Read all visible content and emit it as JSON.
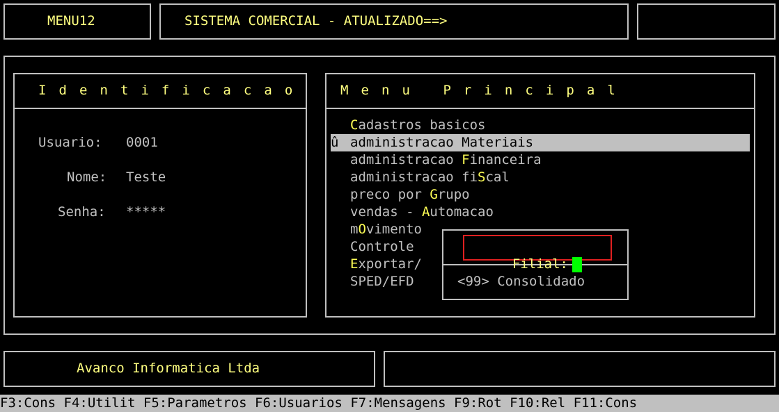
{
  "header": {
    "menu_code": "MENU12",
    "title": "SISTEMA COMERCIAL - ATUALIZADO==>"
  },
  "identificacao": {
    "heading": "Identificacao",
    "usuario_label": "Usuario:",
    "usuario_value": "0001",
    "nome_label": "Nome:",
    "nome_value": "Teste",
    "senha_label": "Senha:",
    "senha_value": "*****"
  },
  "menu": {
    "heading": "Menu Principal",
    "selected_marker": "û",
    "items": [
      {
        "pre": "",
        "hot": "C",
        "post": "adastros basicos"
      },
      {
        "pre": "administracao ",
        "hot": "M",
        "post": "ateriais"
      },
      {
        "pre": "administracao ",
        "hot": "F",
        "post": "inanceira"
      },
      {
        "pre": "administracao fi",
        "hot": "S",
        "post": "cal"
      },
      {
        "pre": "preco por ",
        "hot": "G",
        "post": "rupo"
      },
      {
        "pre": "vendas - ",
        "hot": "A",
        "post": "utomacao"
      },
      {
        "pre": "m",
        "hot": "O",
        "post": "vimento"
      },
      {
        "pre": "",
        "hot": "",
        "post": "Controle"
      },
      {
        "pre": "",
        "hot": "E",
        "post": "xportar/"
      },
      {
        "pre": "",
        "hot": "",
        "post": "SPED/EFD"
      }
    ]
  },
  "dialog": {
    "filial_label": "Filial:",
    "filial_value": "",
    "option": "<99> Consolidado"
  },
  "footer": {
    "company": "Avanco Informatica Ltda"
  },
  "function_keys": "F3:Cons F4:Utilit F5:Parametros F6:Usuarios F7:Mensagens F9:Rot F10:Rel F11:Cons",
  "colors": {
    "background": "#000000",
    "border": "#c0c0c0",
    "highlight": "#ffff80",
    "cursor": "#00ff00",
    "focus_border": "#e02020"
  }
}
